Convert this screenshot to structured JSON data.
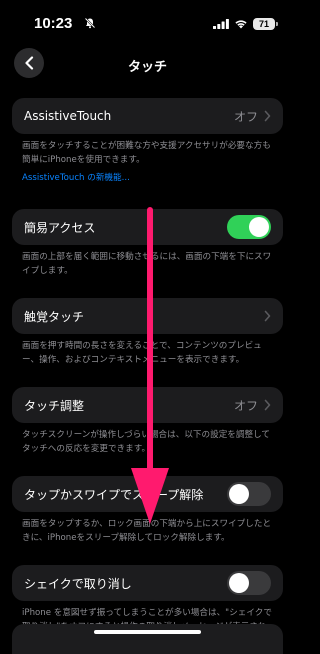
{
  "status_bar": {
    "time": "10:23",
    "battery": "71"
  },
  "nav": {
    "title": "タッチ"
  },
  "sections": {
    "assistive_touch": {
      "label": "AssistiveTouch",
      "value": "オフ",
      "description": "画面をタッチすることが困難な方や支援アクセサリが必要な方も簡単にiPhoneを使用できます。",
      "link": "AssistiveTouch の新機能..."
    },
    "reachability": {
      "label": "簡易アクセス",
      "toggle": "on",
      "description": "画面の上部を届く範囲に移動させるには、画面の下端を下にスワイプします。"
    },
    "haptic_touch": {
      "label": "触覚タッチ",
      "description": "画面を押す時間の長さを変えることで、コンテンツのプレビュー、操作、およびコンテキストメニューを表示できます。"
    },
    "touch_accommodations": {
      "label": "タッチ調整",
      "value": "オフ",
      "description": "タッチスクリーンが操作しづらい場合は、以下の設定を調整してタッチへの反応を変更できます。"
    },
    "tap_to_wake": {
      "label": "タップかスワイプでスリープ解除",
      "toggle": "off",
      "description": "画面をタップするか、ロック画面の下端から上にスワイプしたときに、iPhoneをスリープ解除してロック解除します。"
    },
    "shake_to_undo": {
      "label": "シェイクで取り消し",
      "toggle": "off",
      "description": "iPhone を意図せず振ってしまうことが多い場合は、\"シェイクで取り消し\"をオフにすると操作の取り消しメッセージが表示されないようになります。"
    }
  },
  "colors": {
    "arrow": "#ff1a6e",
    "toggle_on": "#30d158",
    "link": "#0a84ff"
  }
}
